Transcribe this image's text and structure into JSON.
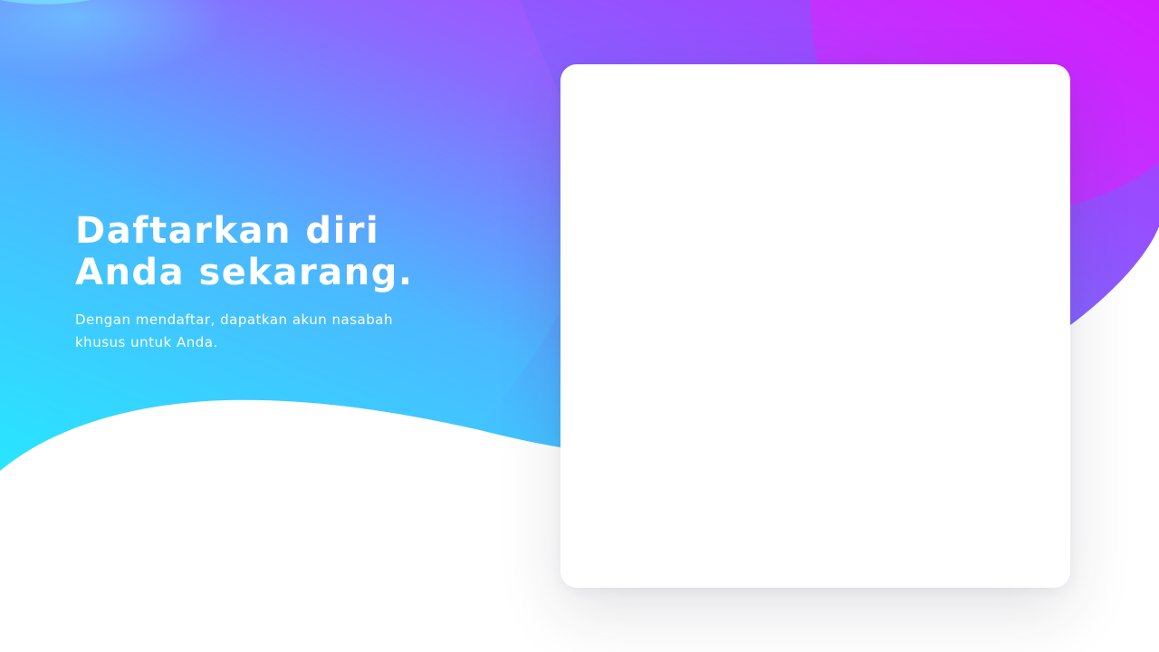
{
  "hero": {
    "title": "Daftarkan diri Anda sekarang.",
    "subtitle": "Dengan mendaftar, dapatkan akun nasabah khusus untuk Anda."
  },
  "theme": {
    "gradient_start": "#27e6ff",
    "gradient_mid": "#5aa6ff",
    "gradient_violet": "#8a6cff",
    "gradient_end": "#d21fff",
    "card_background": "#ffffff"
  },
  "form_card": {
    "content": ""
  }
}
